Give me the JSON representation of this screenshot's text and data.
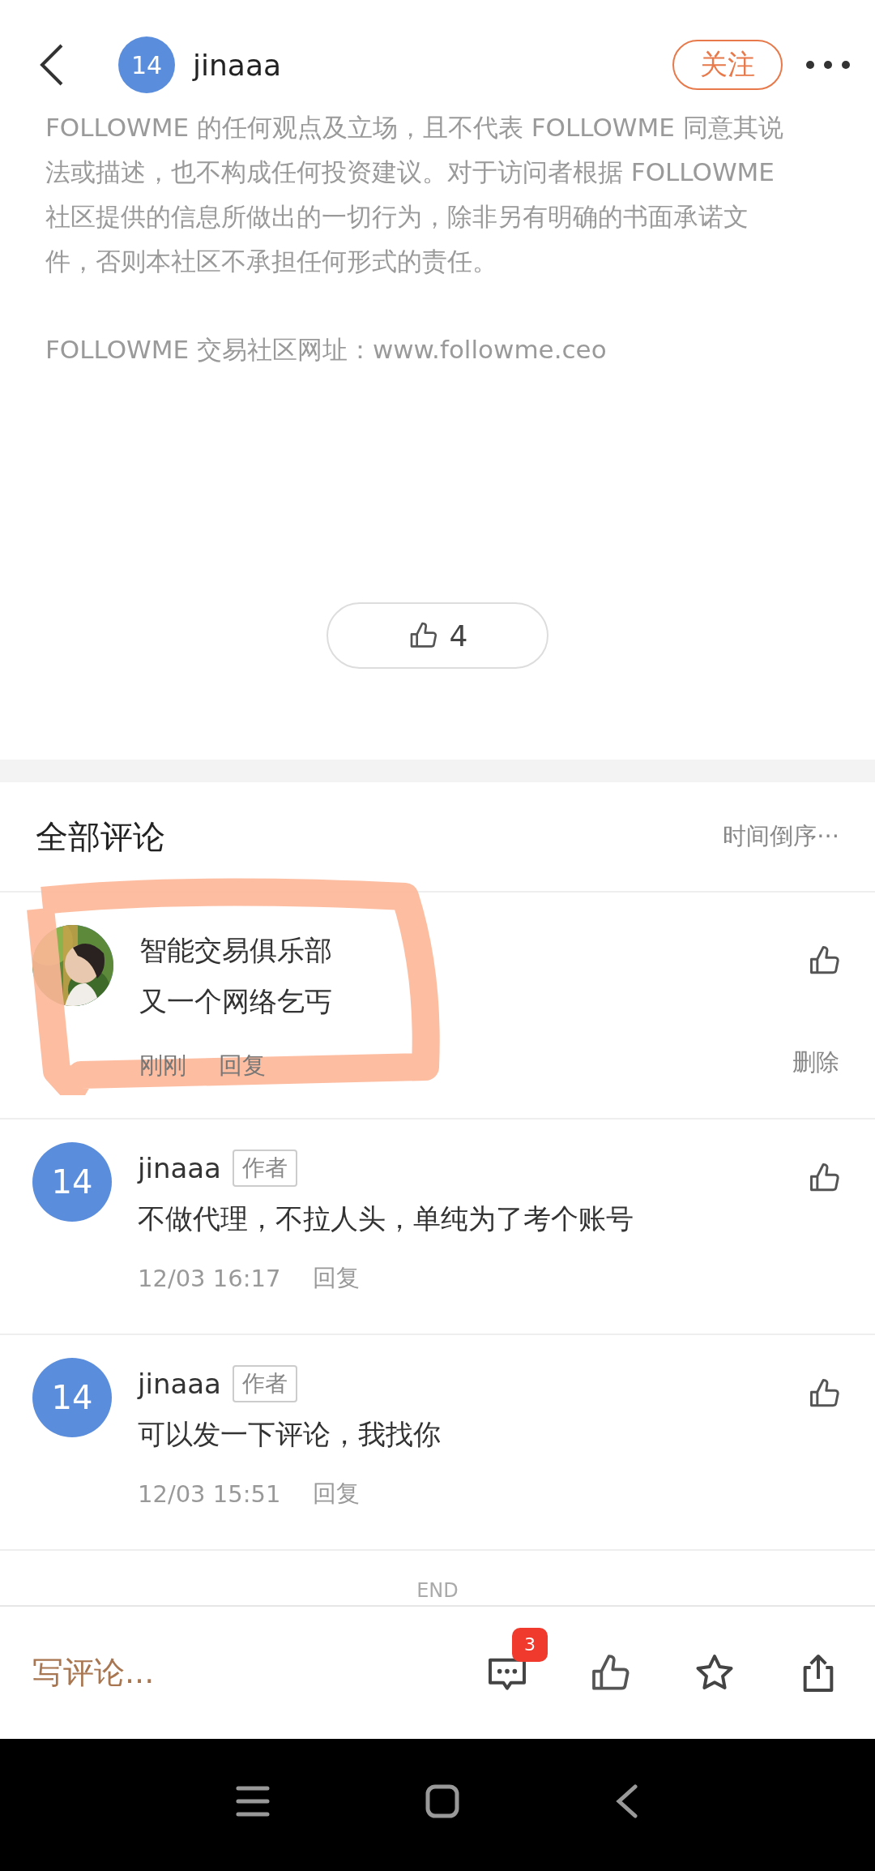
{
  "header": {
    "avatar_text": "14",
    "username": "jinaaa",
    "follow_button": "关注"
  },
  "article": {
    "paragraphs": [
      "FOLLOWME 的任何观点及立场，且不代表 FOLLOWME 同意其说法或描述，也不构成任何投资建议。对于访问者根据 FOLLOWME 社区提供的信息所做出的一切行为，除非另有明确的书面承诺文件，否则本社区不承担任何形式的责任。",
      "FOLLOWME 交易社区网址：www.followme.ceo"
    ]
  },
  "like_button": {
    "count": "4"
  },
  "comments_section": {
    "title": "全部评论",
    "sort": "时间倒序···"
  },
  "comments": [
    {
      "name": "智能交易俱乐部",
      "body": "又一个网络乞丐",
      "time": "刚刚",
      "reply": "回复",
      "delete": "删除",
      "highlighted": true
    },
    {
      "avatar": {
        "kind": "initials",
        "text": "14"
      },
      "name": "jinaaa",
      "tag": "作者",
      "body": "不做代理，不拉人头，单纯为了考个账号",
      "time": "12/03 16:17",
      "reply": "回复",
      "highlighted": false
    },
    {
      "avatar": {
        "kind": "initials",
        "text": "14"
      },
      "name": "jinaaa",
      "tag": "作者",
      "body": "可以发一下评论，我找你",
      "time": "12/03 15:51",
      "reply": "回复",
      "highlighted": false
    }
  ],
  "end_text": "END",
  "bottom_bar": {
    "comment_placeholder": "写评论...",
    "comment_badge": "3"
  }
}
